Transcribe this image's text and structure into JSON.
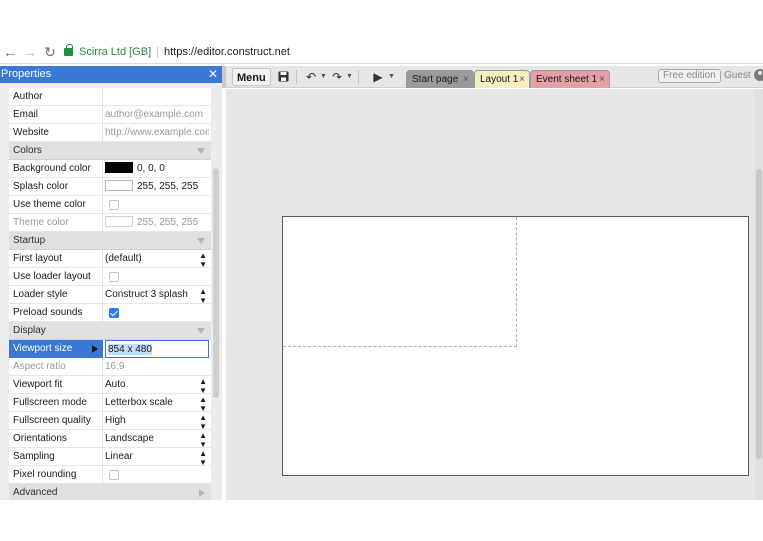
{
  "browser": {
    "back_icon": "arrow-left-icon",
    "forward_icon": "arrow-right-icon",
    "reload_icon": "reload-icon",
    "site_identity": "Scirra Ltd [GB]",
    "url": "https://editor.construct.net"
  },
  "properties_panel": {
    "title": "Properties",
    "close_icon": "close-icon",
    "rows": {
      "author": {
        "label": "Author",
        "value": ""
      },
      "email": {
        "label": "Email",
        "value": "author@example.com"
      },
      "website": {
        "label": "Website",
        "value": "http://www.example.com"
      },
      "colors": {
        "label": "Colors"
      },
      "background_color": {
        "label": "Background color",
        "value": "0, 0, 0",
        "swatch": "#000000"
      },
      "splash_color": {
        "label": "Splash color",
        "value": "255, 255, 255",
        "swatch": "#ffffff"
      },
      "use_theme_color": {
        "label": "Use theme color",
        "checked": false
      },
      "theme_color": {
        "label": "Theme color",
        "value": "255, 255, 255",
        "swatch": "#ffffff"
      },
      "startup": {
        "label": "Startup"
      },
      "first_layout": {
        "label": "First layout",
        "value": "(default)"
      },
      "use_loader_layout": {
        "label": "Use loader layout",
        "checked": false
      },
      "loader_style": {
        "label": "Loader style",
        "value": "Construct 3 splash"
      },
      "preload_sounds": {
        "label": "Preload sounds",
        "checked": true
      },
      "display": {
        "label": "Display"
      },
      "viewport_size": {
        "label": "Viewport size",
        "value": "854 x 480"
      },
      "aspect_ratio": {
        "label": "Aspect ratio",
        "value": "16:9"
      },
      "viewport_fit": {
        "label": "Viewport fit",
        "value": "Auto"
      },
      "fullscreen_mode": {
        "label": "Fullscreen mode",
        "value": "Letterbox scale"
      },
      "fullscreen_quality": {
        "label": "Fullscreen quality",
        "value": "High"
      },
      "orientations": {
        "label": "Orientations",
        "value": "Landscape"
      },
      "sampling": {
        "label": "Sampling",
        "value": "Linear"
      },
      "pixel_rounding": {
        "label": "Pixel rounding",
        "checked": false
      },
      "advanced": {
        "label": "Advanced"
      }
    }
  },
  "toolbar": {
    "menu_label": "Menu",
    "save_icon": "floppy-disk-icon",
    "undo_icon": "undo-icon",
    "redo_icon": "redo-icon",
    "play_icon": "play-icon",
    "tabs": [
      {
        "label": "Start page",
        "color": "#9a9a9a"
      },
      {
        "label": "Layout 1",
        "color": "#f7edc0"
      },
      {
        "label": "Event sheet 1",
        "color": "#e4a0a4"
      }
    ],
    "edition_label": "Free edition",
    "user_label": "Guest",
    "user_icon": "user-icon"
  },
  "colors": {
    "accent": "#3a78d8",
    "secure_green": "#1e8e3e"
  }
}
